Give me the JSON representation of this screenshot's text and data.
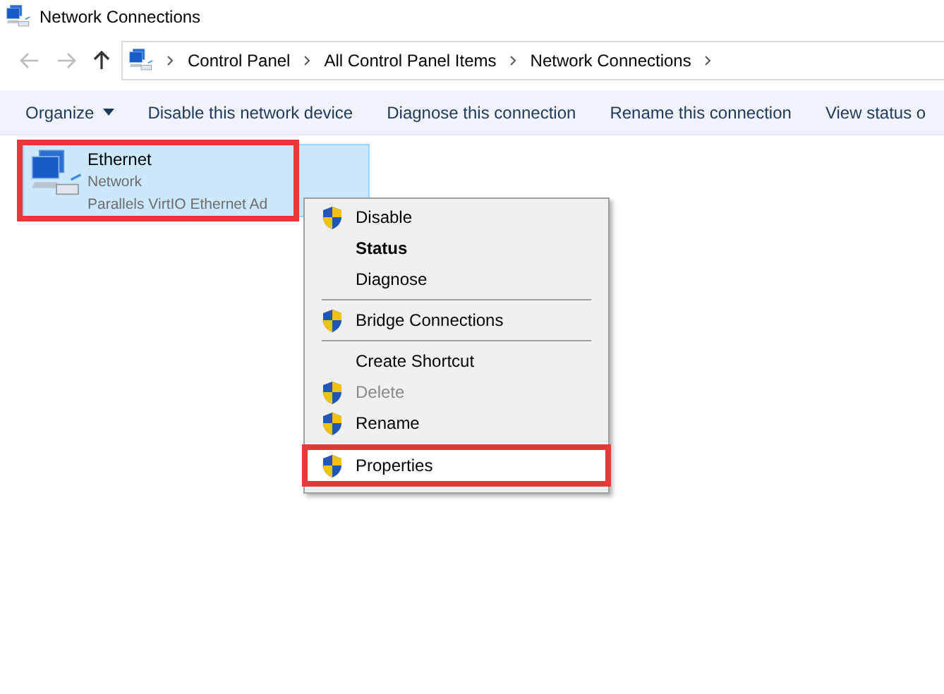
{
  "window": {
    "title": "Network Connections"
  },
  "address_bar": {
    "crumbs": [
      "Control Panel",
      "All Control Panel Items",
      "Network Connections"
    ]
  },
  "toolbar": {
    "items": [
      {
        "label": "Organize",
        "dropdown": true
      },
      {
        "label": "Disable this network device",
        "dropdown": false
      },
      {
        "label": "Diagnose this connection",
        "dropdown": false
      },
      {
        "label": "Rename this connection",
        "dropdown": false
      },
      {
        "label": "View status o",
        "dropdown": false
      }
    ]
  },
  "connections": [
    {
      "name": "Ethernet",
      "network": "Network",
      "adapter": "Parallels VirtIO Ethernet Ad",
      "selected": true,
      "annotated": true
    }
  ],
  "context_menu": {
    "items": [
      {
        "kind": "item",
        "label": "Disable",
        "shield": true,
        "bold": false,
        "disabled": false,
        "selected": false,
        "annotated": false
      },
      {
        "kind": "item",
        "label": "Status",
        "shield": false,
        "bold": true,
        "disabled": false,
        "selected": false,
        "annotated": false
      },
      {
        "kind": "item",
        "label": "Diagnose",
        "shield": false,
        "bold": false,
        "disabled": false,
        "selected": false,
        "annotated": false
      },
      {
        "kind": "separator"
      },
      {
        "kind": "item",
        "label": "Bridge Connections",
        "shield": true,
        "bold": false,
        "disabled": false,
        "selected": false,
        "annotated": false
      },
      {
        "kind": "separator"
      },
      {
        "kind": "item",
        "label": "Create Shortcut",
        "shield": false,
        "bold": false,
        "disabled": false,
        "selected": false,
        "annotated": false
      },
      {
        "kind": "item",
        "label": "Delete",
        "shield": true,
        "bold": false,
        "disabled": true,
        "selected": false,
        "annotated": false
      },
      {
        "kind": "item",
        "label": "Rename",
        "shield": true,
        "bold": false,
        "disabled": false,
        "selected": false,
        "annotated": false
      },
      {
        "kind": "item",
        "label": "Properties",
        "shield": true,
        "bold": false,
        "disabled": false,
        "selected": true,
        "annotated": true
      }
    ]
  }
}
